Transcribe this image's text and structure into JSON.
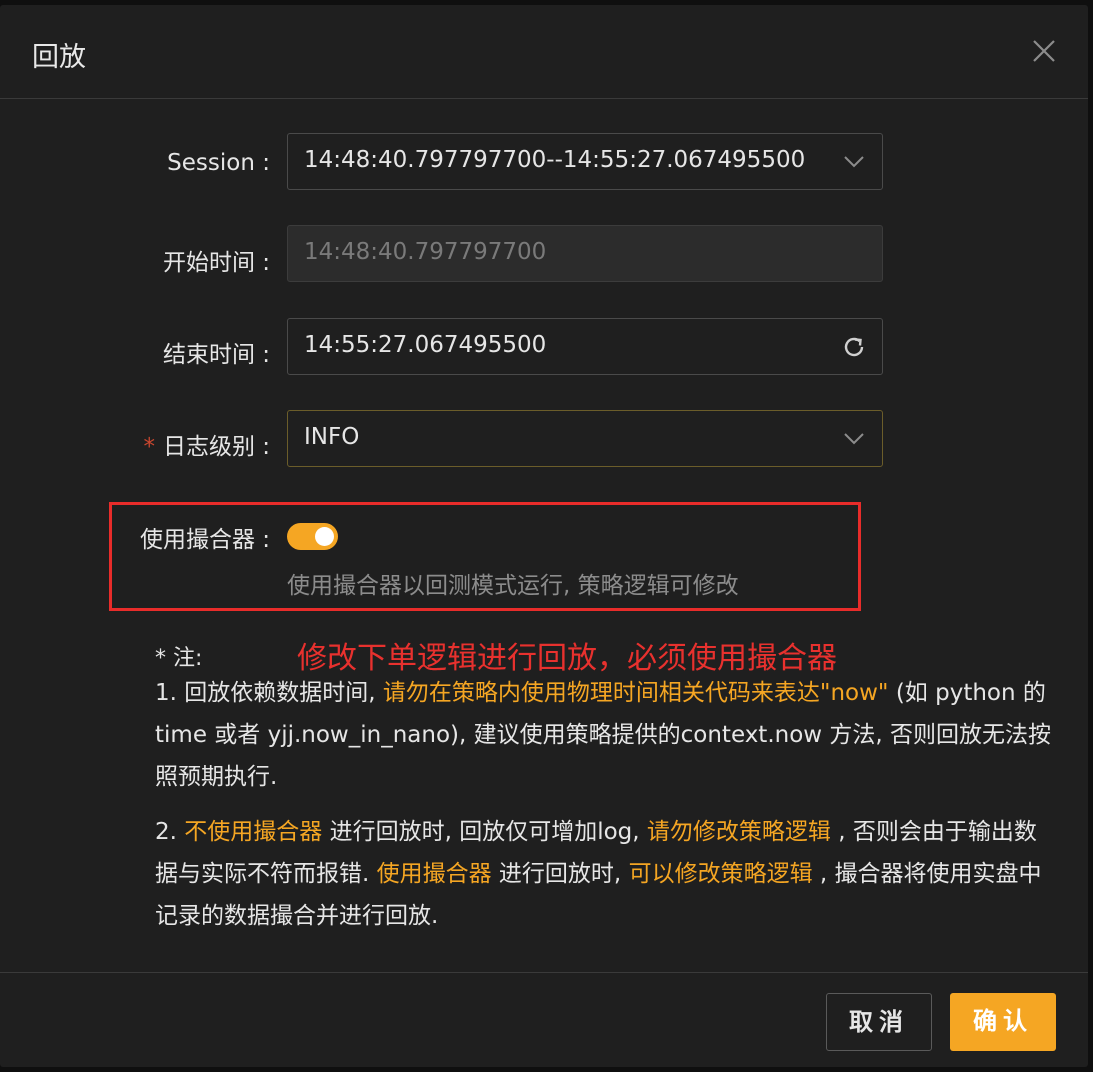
{
  "modal": {
    "title": "回放"
  },
  "form": {
    "session": {
      "label": "Session",
      "value": "14:48:40.797797700--14:55:27.067495500"
    },
    "start_time": {
      "label": "开始时间",
      "value": "14:48:40.797797700"
    },
    "end_time": {
      "label": "结束时间",
      "value": "14:55:27.067495500"
    },
    "log_level": {
      "required_mark": "*",
      "label": "日志级别",
      "value": "INFO"
    },
    "use_matcher": {
      "label": "使用撮合器",
      "enabled": true,
      "help": "使用撮合器以回测模式运行, 策略逻辑可修改"
    },
    "colon": ":"
  },
  "annotation": "修改下单逻辑进行回放，必须使用撮合器",
  "notes": {
    "title": "* 注:",
    "p1": {
      "a": "1. 回放依赖数据时间, ",
      "b": "请勿在策略内使用物理时间相关代码来表达\"now\"",
      "c": " (如 python 的 time 或者 yjj.now_in_nano), 建议使用策略提供的context.now 方法, 否则回放无法按照预期执行."
    },
    "p2": {
      "a": "2. ",
      "b": "不使用撮合器",
      "c": " 进行回放时, 回放仅可增加log, ",
      "d": "请勿修改策略逻辑",
      "e": " , 否则会由于输出数据与实际不符而报错. ",
      "f": "使用撮合器",
      "g": " 进行回放时, ",
      "h": "可以修改策略逻辑",
      "i": " ,  撮合器将使用实盘中记录的数据撮合并进行回放."
    }
  },
  "footer": {
    "cancel_label": "取消",
    "ok_label": "确认"
  },
  "colors": {
    "accent": "#f5a623",
    "annotation_red": "#e82c2a"
  }
}
